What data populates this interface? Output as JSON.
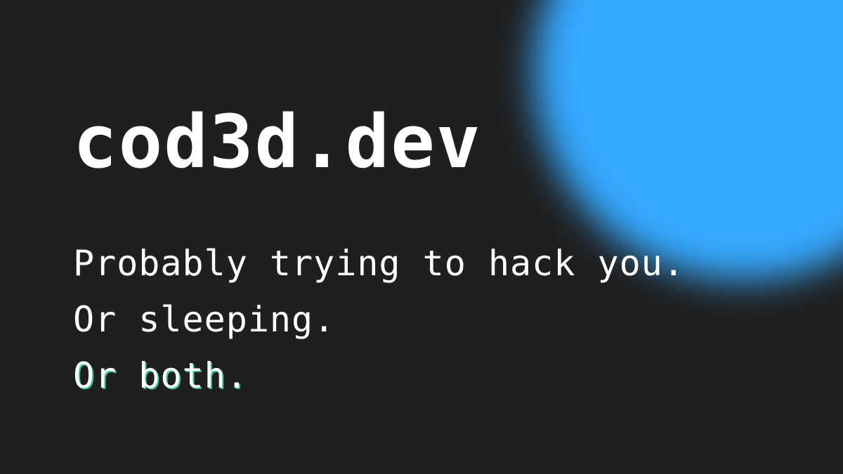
{
  "title": "cod3d.dev",
  "tagline": {
    "line1": "Probably trying to hack you.",
    "line2": "Or sleeping.",
    "line3": "Or both."
  },
  "colors": {
    "background": "#1f1f1f",
    "glow": "#36a9ff",
    "text": "#ffffff",
    "accent_shadow": "#3fbf96"
  }
}
